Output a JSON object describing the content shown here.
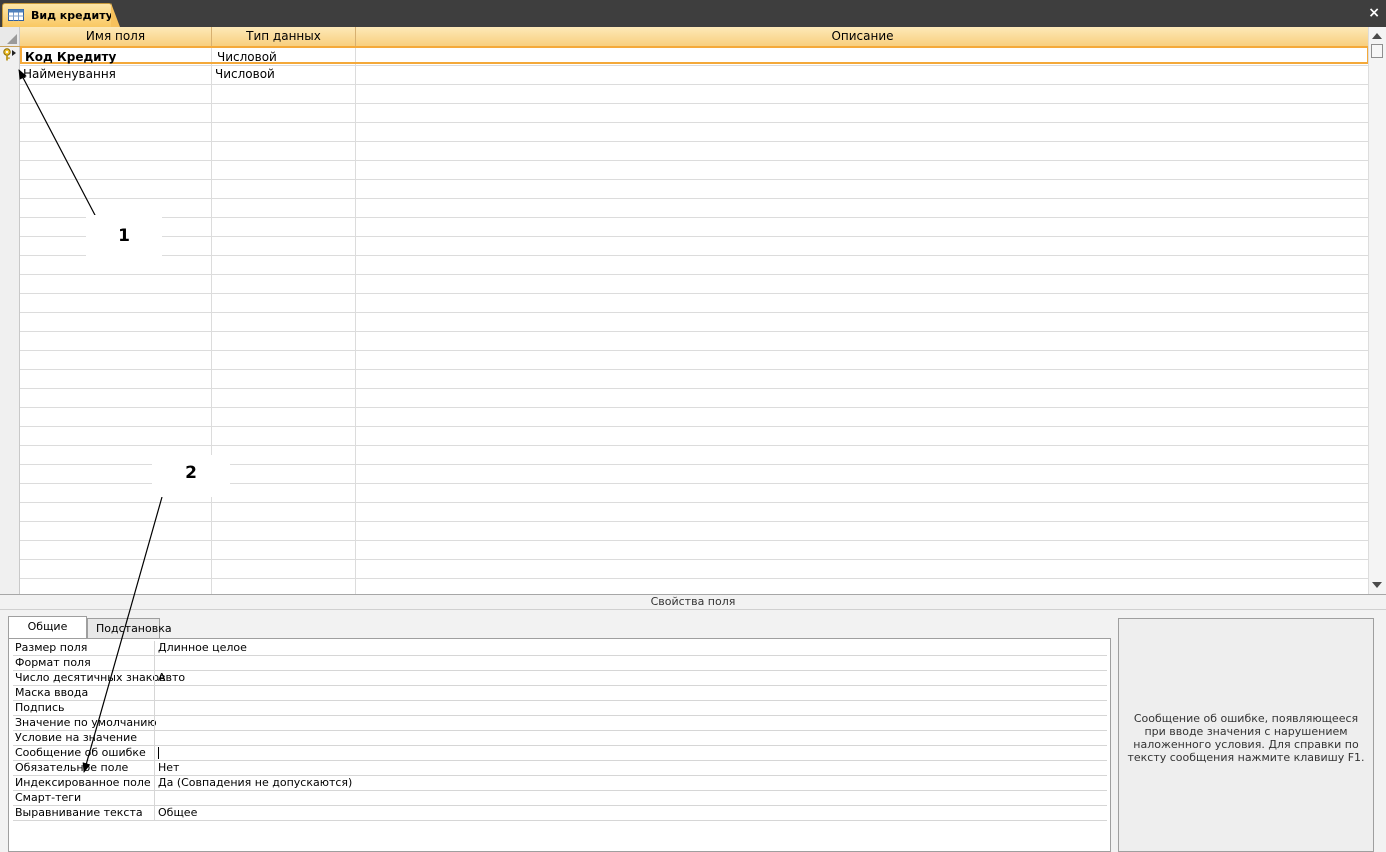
{
  "window": {
    "tab_title": "Вид кредиту",
    "close_symbol": "×"
  },
  "grid": {
    "headers": {
      "field_name": "Имя поля",
      "data_type": "Тип данных",
      "description": "Описание"
    },
    "rows": [
      {
        "field_name": "Код Кредиту",
        "data_type": "Числовой",
        "description": "",
        "primary_key": true
      },
      {
        "field_name": "Найменування",
        "data_type": "Числовой",
        "description": ""
      }
    ]
  },
  "properties": {
    "title": "Свойства поля",
    "tabs": [
      {
        "label": "Общие",
        "selected": true
      },
      {
        "label": "Подстановка",
        "selected": false
      }
    ],
    "items": [
      {
        "label": "Размер поля",
        "value": "Длинное целое"
      },
      {
        "label": "Формат поля",
        "value": ""
      },
      {
        "label": "Число десятичных знаков",
        "value": "Авто"
      },
      {
        "label": "Маска ввода",
        "value": ""
      },
      {
        "label": "Подпись",
        "value": ""
      },
      {
        "label": "Значение по умолчанию",
        "value": ""
      },
      {
        "label": "Условие на значение",
        "value": ""
      },
      {
        "label": "Сообщение об ошибке",
        "value": ""
      },
      {
        "label": "Обязательное поле",
        "value": "Нет"
      },
      {
        "label": "Индексированное поле",
        "value": "Да (Совпадения не допускаются)"
      },
      {
        "label": "Смарт-теги",
        "value": ""
      },
      {
        "label": "Выравнивание текста",
        "value": "Общее"
      }
    ],
    "help_text": "Сообщение об ошибке, появляющееся при вводе значения с нарушением наложенного условия.  Для справки по тексту сообщения нажмите клавишу F1."
  },
  "annotations": {
    "callout_1": "1",
    "callout_2": "2"
  },
  "colors": {
    "header_gradient_top": "#fde9b8",
    "header_gradient_bottom": "#f8cf7e",
    "active_row_border": "#f4a93a",
    "title_bar": "#3e3e3e"
  }
}
